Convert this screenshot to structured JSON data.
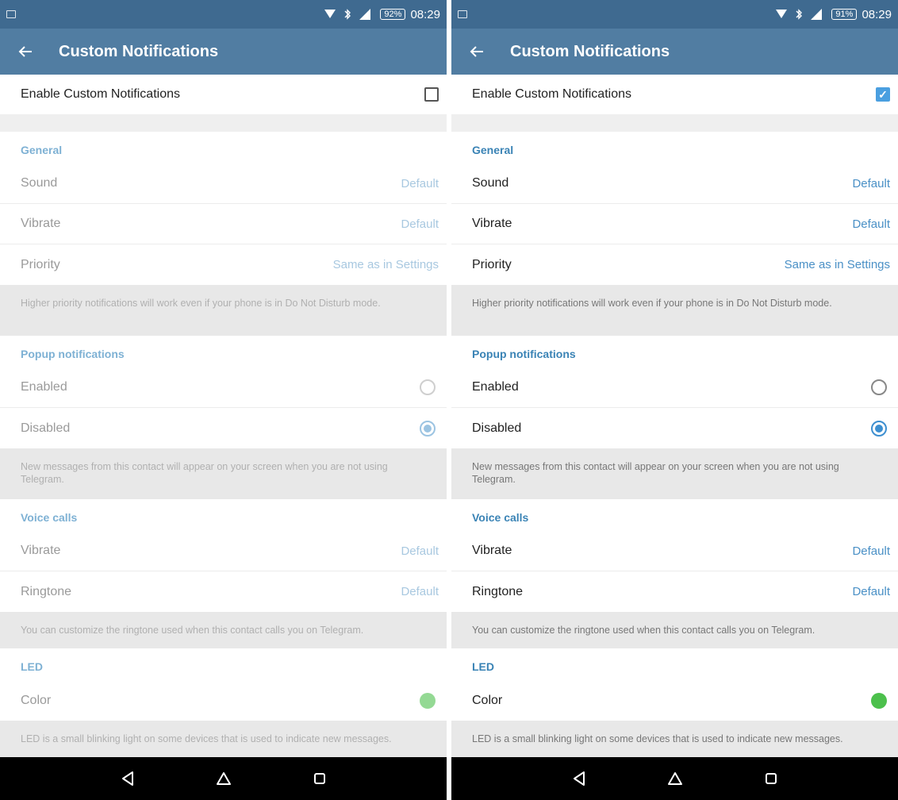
{
  "screens": [
    {
      "status": {
        "battery": "92%",
        "time": "08:29"
      },
      "title": "Custom Notifications",
      "enable_label": "Enable Custom Notifications",
      "enabled": false,
      "general": {
        "header": "General",
        "sound_label": "Sound",
        "sound_value": "Default",
        "vibrate_label": "Vibrate",
        "vibrate_value": "Default",
        "priority_label": "Priority",
        "priority_value": "Same as in Settings",
        "note": "Higher priority notifications will work even if your phone is in Do Not Disturb mode."
      },
      "popup": {
        "header": "Popup notifications",
        "enabled_label": "Enabled",
        "disabled_label": "Disabled",
        "selected": "Disabled",
        "note": "New messages from this contact will appear on your screen when you are not using Telegram."
      },
      "voice": {
        "header": "Voice calls",
        "vibrate_label": "Vibrate",
        "vibrate_value": "Default",
        "ringtone_label": "Ringtone",
        "ringtone_value": "Default",
        "note": "You can customize the ringtone used when this contact calls you on Telegram."
      },
      "led": {
        "header": "LED",
        "color_label": "Color",
        "color": "#4cc04c",
        "note": "LED is a small blinking light on some devices that is used to indicate new messages."
      }
    },
    {
      "status": {
        "battery": "91%",
        "time": "08:29"
      },
      "title": "Custom Notifications",
      "enable_label": "Enable Custom Notifications",
      "enabled": true,
      "general": {
        "header": "General",
        "sound_label": "Sound",
        "sound_value": "Default",
        "vibrate_label": "Vibrate",
        "vibrate_value": "Default",
        "priority_label": "Priority",
        "priority_value": "Same as in Settings",
        "note": "Higher priority notifications will work even if your phone is in Do Not Disturb mode."
      },
      "popup": {
        "header": "Popup notifications",
        "enabled_label": "Enabled",
        "disabled_label": "Disabled",
        "selected": "Disabled",
        "note": "New messages from this contact will appear on your screen when you are not using Telegram."
      },
      "voice": {
        "header": "Voice calls",
        "vibrate_label": "Vibrate",
        "vibrate_value": "Default",
        "ringtone_label": "Ringtone",
        "ringtone_value": "Default",
        "note": "You can customize the ringtone used when this contact calls you on Telegram."
      },
      "led": {
        "header": "LED",
        "color_label": "Color",
        "color": "#4cc04c",
        "note": "LED is a small blinking light on some devices that is used to indicate new messages."
      }
    }
  ],
  "icons": {
    "back": "arrow-left-icon",
    "nav_back": "triangle-back-icon",
    "nav_home": "home-icon",
    "nav_recents": "square-recents-icon"
  }
}
